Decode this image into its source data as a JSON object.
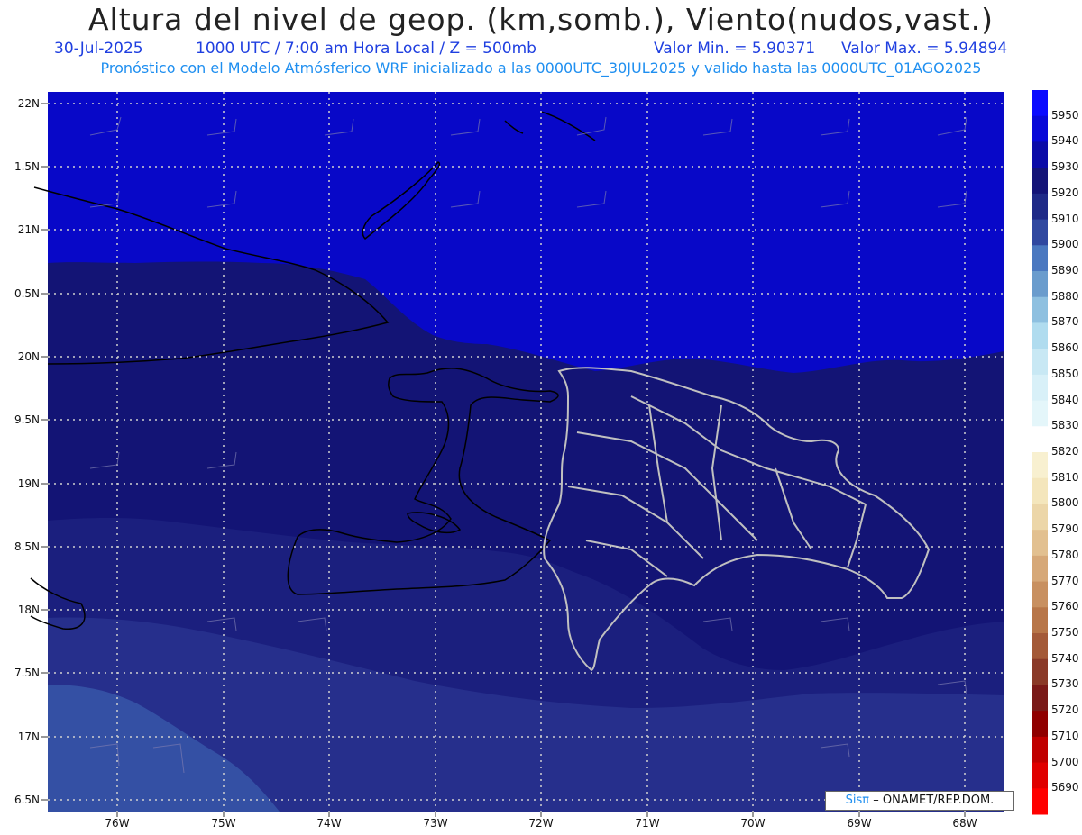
{
  "header": {
    "title": "Altura del nivel de geop. (km,somb.), Viento(nudos,vast.)",
    "date": "30-Jul-2025",
    "time": "1000 UTC / 7:00 am Hora Local / Z = 500mb",
    "min": "Valor Min. = 5.90371",
    "max": "Valor Max. = 5.94894",
    "subtitle": "Pronóstico con el Modelo Atmósferico WRF inicializado a las 0000UTC_30JUL2025 y valido hasta las  0000UTC_01AGO2025"
  },
  "axes": {
    "lat_labels": [
      "22N",
      "1.5N",
      "21N",
      "0.5N",
      "20N",
      "9.5N",
      "19N",
      "8.5N",
      "18N",
      "7.5N",
      "17N",
      "6.5N"
    ],
    "lon_labels": [
      "76W",
      "75W",
      "74W",
      "73W",
      "72W",
      "71W",
      "70W",
      "69W",
      "68W"
    ]
  },
  "colorbar": {
    "labels": [
      "5950",
      "5940",
      "5930",
      "5920",
      "5910",
      "5900",
      "5890",
      "5880",
      "5870",
      "5860",
      "5850",
      "5840",
      "5830",
      "5820",
      "5810",
      "5800",
      "5790",
      "5780",
      "5770",
      "5760",
      "5750",
      "5740",
      "5730",
      "5720",
      "5710",
      "5700",
      "5690"
    ],
    "colors": [
      "#0a0aff",
      "#0808d8",
      "#0b0ba8",
      "#141478",
      "#1f2a88",
      "#3048a0",
      "#4a78c0",
      "#6a9ccd",
      "#8ec0e0",
      "#b0dcef",
      "#c8e8f4",
      "#d8f0f8",
      "#e4f6fa",
      "#ffffff",
      "#f8f0d0",
      "#f4e6bc",
      "#ecd6a8",
      "#e2c090",
      "#d6a878",
      "#c89060",
      "#b87648",
      "#a45a38",
      "#8a3a28",
      "#7a1a18",
      "#900000",
      "#c00000",
      "#e00000",
      "#ff0000"
    ]
  },
  "map_colors": {
    "band_5940": "#0808c8",
    "band_5930": "#131475",
    "band_5920": "#1b1f7e",
    "band_5910": "#262f8c",
    "band_5900": "#3450a4"
  },
  "credit": {
    "brand": "Sisπ",
    "text": "– ONAMET/REP.DOM."
  }
}
